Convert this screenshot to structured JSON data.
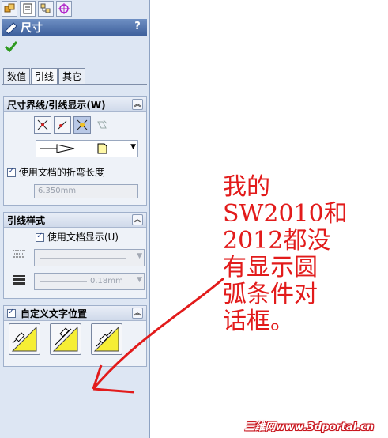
{
  "panel": {
    "top_tabs": [
      {
        "icon": "feature-manager-icon"
      },
      {
        "icon": "property-manager-icon"
      },
      {
        "icon": "configuration-manager-icon"
      },
      {
        "icon": "dimxpert-icon"
      }
    ],
    "title": "尺寸",
    "help": "?",
    "tabs": [
      {
        "label": "数值",
        "active": false
      },
      {
        "label": "引线",
        "active": true
      },
      {
        "label": "其它",
        "active": false
      }
    ],
    "sections": {
      "witness": {
        "title": "尺寸界线/引线显示(W)",
        "use_doc_bend": "使用文档的折弯长度",
        "use_doc_bend_checked": true,
        "bend_length": "6.350mm"
      },
      "leader_style": {
        "title": "引线样式",
        "use_doc_display": "使用文档显示(U)",
        "use_doc_display_checked": true,
        "thickness": "0.18mm"
      },
      "custom_text": {
        "title": "自定义文字位置",
        "checked": true
      }
    }
  },
  "annotation": {
    "lines": [
      "我的",
      "SW2010和",
      "2012都没",
      "有显示圆",
      "弧条件对",
      "话框。"
    ],
    "color": "#e21b1b"
  },
  "watermark": "三维网www.3dportal.cn"
}
